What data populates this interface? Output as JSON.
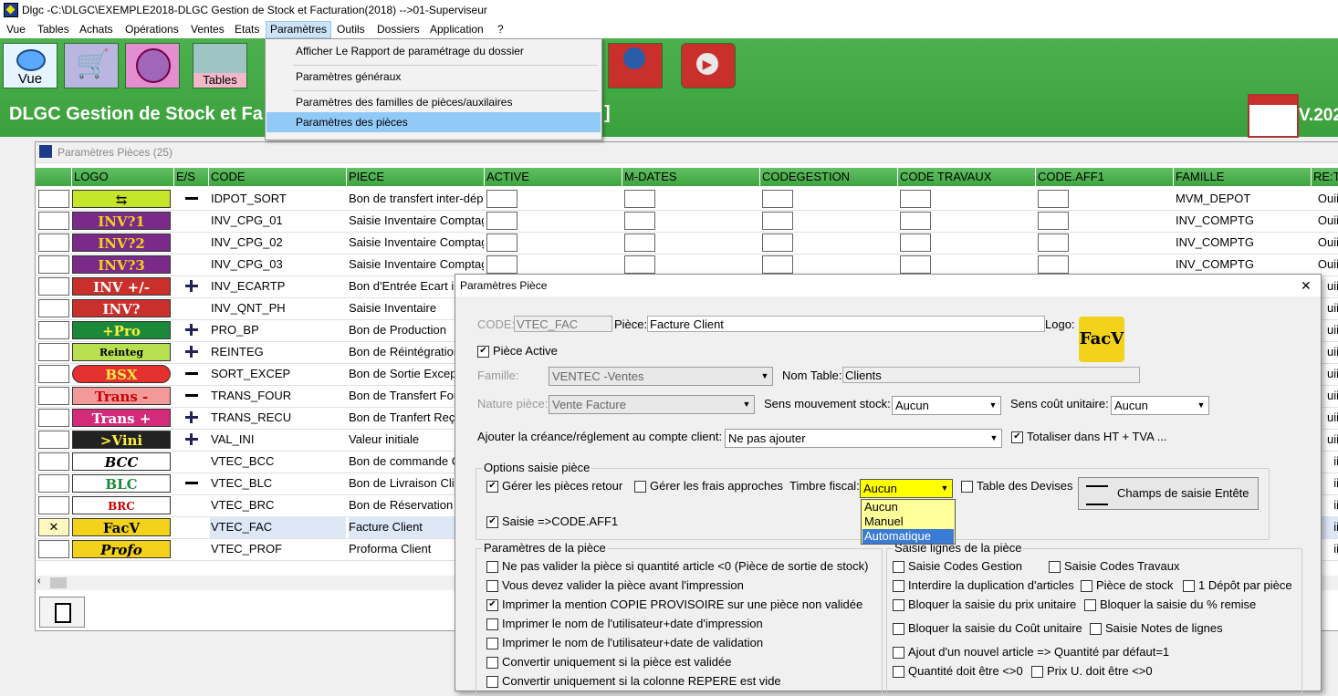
{
  "window": {
    "title": "Dlgc -C:\\DLGC\\EXEMPLE2018-DLGC Gestion de Stock et Facturation(2018) -->01-Superviseur"
  },
  "menu": [
    "Vue",
    "Tables",
    "Achats",
    "Opérations",
    "Ventes",
    "Etats",
    "Paramètres",
    "Outils",
    "Dossiers",
    "Application",
    "?"
  ],
  "toolbar": {
    "vue_label": "Vue",
    "tables_label": "Tables",
    "heading": "DLGC Gestion de Stock et Fa",
    "heading_tail": "]",
    "version": "V.202"
  },
  "dropdown": {
    "items": [
      "Afficher Le Rapport de paramétrage du dossier",
      "Paramètres généraux",
      "Paramètres des familles de pièces/auxilaires",
      "Paramètres des pièces"
    ],
    "selected_index": 3
  },
  "child": {
    "title": "Paramètres Pièces (25)"
  },
  "grid": {
    "headers": [
      "LOGO",
      "E/S",
      "CODE",
      "PIECE",
      "ACTIVE",
      "M-DATES",
      "CODEGESTION",
      "CODE TRAVAUX",
      "CODE.AFF1",
      "FAMILLE",
      "RE:T"
    ],
    "rows": [
      {
        "logo": "⇆",
        "es": "minus",
        "code": "IDPOT_SORT",
        "piece": "Bon de transfert inter-dépot",
        "famille": "MVM_DEPOT",
        "ret": "Ouii"
      },
      {
        "logo": "INV?1",
        "es": "",
        "code": "INV_CPG_01",
        "piece": "Saisie Inventaire Comptage",
        "famille": "INV_COMPTG",
        "ret": "Ouii"
      },
      {
        "logo": "INV?2",
        "es": "",
        "code": "INV_CPG_02",
        "piece": "Saisie Inventaire Comptage",
        "famille": "INV_COMPTG",
        "ret": "Ouii"
      },
      {
        "logo": "INV?3",
        "es": "",
        "code": "INV_CPG_03",
        "piece": "Saisie Inventaire Comptage",
        "famille": "INV_COMPTG",
        "ret": "Ouii"
      },
      {
        "logo": "INV +/-",
        "es": "plus",
        "code": "INV_ECARTP",
        "piece": "Bon d'Entrée Ecart in",
        "famille": "",
        "ret": "uii"
      },
      {
        "logo": "INV?",
        "es": "",
        "code": "INV_QNT_PH",
        "piece": "Saisie Inventaire",
        "famille": "",
        "ret": "uii"
      },
      {
        "logo": "+Pro",
        "es": "plus",
        "code": "PRO_BP",
        "piece": "Bon de Production",
        "famille": "",
        "ret": "uii"
      },
      {
        "logo": "Reinteg",
        "es": "plus",
        "code": "REINTEG",
        "piece": "Bon de Réintégration",
        "famille": "",
        "ret": "uii"
      },
      {
        "logo": "BSX",
        "es": "minus",
        "code": "SORT_EXCEP",
        "piece": "Bon de Sortie Excep",
        "famille": "",
        "ret": "uii"
      },
      {
        "logo": "Trans -",
        "es": "minus",
        "code": "TRANS_FOUR",
        "piece": "Bon de Transfert Fou",
        "famille": "",
        "ret": "uii"
      },
      {
        "logo": "Trans +",
        "es": "plus",
        "code": "TRANS_RECU",
        "piece": "Bon de Tranfert Reçu",
        "famille": "",
        "ret": "uii"
      },
      {
        "logo": ">Vini",
        "es": "plus",
        "code": "VAL_INI",
        "piece": "Valeur initiale",
        "famille": "",
        "ret": "uii"
      },
      {
        "logo": "BCC",
        "es": "",
        "code": "VTEC_BCC",
        "piece": "Bon de commande C",
        "famille": "",
        "ret": "ii"
      },
      {
        "logo": "BLC",
        "es": "minus",
        "code": "VTEC_BLC",
        "piece": "Bon de Livraison Clie",
        "famille": "",
        "ret": "ii"
      },
      {
        "logo": "BRC",
        "es": "",
        "code": "VTEC_BRC",
        "piece": "Bon de Réservation C",
        "famille": "",
        "ret": "ii"
      },
      {
        "logo": "FacV",
        "es": "",
        "code": "VTEC_FAC",
        "piece": "Facture Client",
        "famille": "",
        "ret": "ii"
      },
      {
        "logo": "Profo",
        "es": "",
        "code": "VTEC_PROF",
        "piece": "Proforma Client",
        "famille": "",
        "ret": "ii"
      }
    ]
  },
  "dialog": {
    "title": "Paramètres Pièce",
    "close": "✕",
    "code_label": "CODE:",
    "code_value": "VTEC_FAC",
    "piece_label": "Pièce:",
    "piece_value": "Facture Client",
    "logo_label": "Logo:",
    "logo_text": "FacV",
    "active_label": "Pièce Active",
    "famille_label": "Famille:",
    "famille_value": "VENTEC    -Ventes",
    "nomtable_label": "Nom Table:",
    "nomtable_value": "Clients",
    "nature_label": "Nature pièce:",
    "nature_value": "Vente Facture",
    "sens_stock_label": "Sens mouvement stock:",
    "sens_stock_value": "Aucun",
    "sens_cout_label": "Sens coût unitaire:",
    "sens_cout_value": "Aucun",
    "creance_label": "Ajouter la créance/réglement au compte client:",
    "creance_value": "Ne pas ajouter",
    "totaliser_label": "Totaliser dans HT + TVA ...",
    "options_title": "Options saisie pièce",
    "gerer_retour": "Gérer les pièces retour",
    "gerer_frais": "Gérer les frais approches",
    "timbre_label": "Timbre fiscal:",
    "timbre_value": "Aucun",
    "timbre_options": [
      "Aucun",
      "Manuel",
      "Automatique"
    ],
    "table_devises": "Table des Devises",
    "champs_btn": "Champs de saisie Entête",
    "saisie_aff1": "Saisie =>CODE.AFF1",
    "params_title": "Paramètres de la pièce",
    "params": [
      {
        "label": "Ne pas valider la pièce si quantité article <0 (Pièce de sortie de stock)",
        "checked": false
      },
      {
        "label": "Vous devez valider la pièce avant l'impression",
        "checked": false
      },
      {
        "label": "Imprimer la mention COPIE PROVISOIRE sur une pièce non validée",
        "checked": true
      },
      {
        "label": "Imprimer le nom de l'utilisateur+date d'impression",
        "checked": false
      },
      {
        "label": "Imprimer le nom de l'utilisateur+date de validation",
        "checked": false
      },
      {
        "label": "Convertir uniquement si la pièce est validée",
        "checked": false
      },
      {
        "label": "Convertir uniquement si la colonne REPERE est vide",
        "checked": false
      }
    ],
    "lignes_title": "Saisie lignes de la pièce",
    "lignes": {
      "codes_gestion": "Saisie Codes Gestion",
      "codes_travaux": "Saisie Codes Travaux",
      "interdire": "Interdire la duplication d'articles",
      "piece_stock": "Pièce de stock",
      "un_depot": "1 Dépôt par pièce",
      "bloquer_prix": "Bloquer la saisie du prix unitaire",
      "bloquer_remise": "Bloquer la saisie du % remise",
      "bloquer_cout": "Bloquer la saisie du Coût unitaire",
      "notes": "Saisie Notes de lignes",
      "ajout": "Ajout d'un nouvel article => Quantité par défaut=1",
      "qte_diff": "Quantité doit être <>0",
      "prix_diff": "Prix U. doit être <>0"
    }
  }
}
